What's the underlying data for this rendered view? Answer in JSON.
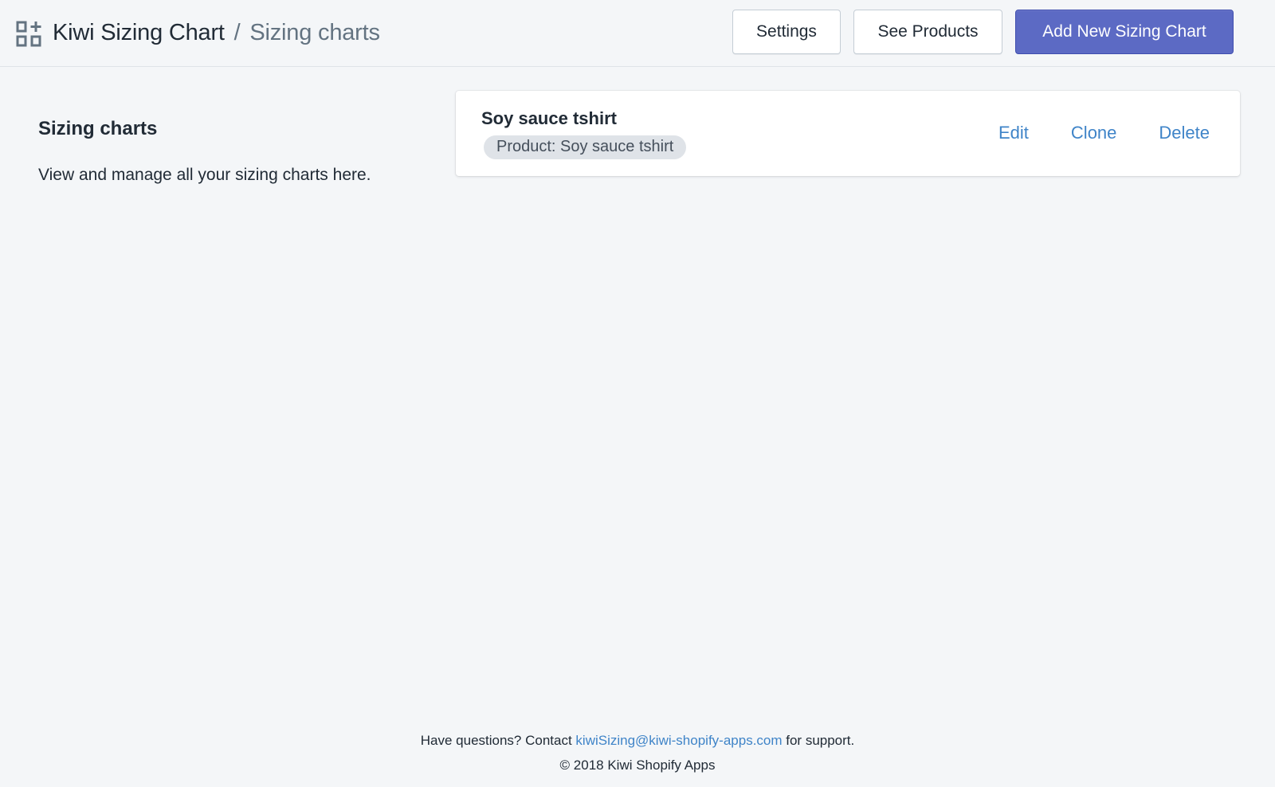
{
  "header": {
    "app_title": "Kiwi Sizing Chart",
    "separator": "/",
    "page_title": "Sizing charts",
    "icon": "apps-add-icon",
    "buttons": {
      "settings": "Settings",
      "see_products": "See Products",
      "add_new": "Add New Sizing Chart"
    }
  },
  "annotation": {
    "title": "Sizing charts",
    "description": "View and manage all your sizing charts here."
  },
  "charts": [
    {
      "name": "Soy sauce tshirt",
      "badge": "Product: Soy sauce tshirt",
      "actions": {
        "edit": "Edit",
        "clone": "Clone",
        "delete": "Delete"
      }
    }
  ],
  "footer": {
    "prefix": "Have questions? Contact ",
    "email": "kiwiSizing@kiwi-shopify-apps.com",
    "suffix": " for support.",
    "copyright": "© 2018 Kiwi Shopify Apps"
  },
  "colors": {
    "primary": "#5c6ac4",
    "link": "#3f84c8",
    "background": "#f4f6f8"
  }
}
